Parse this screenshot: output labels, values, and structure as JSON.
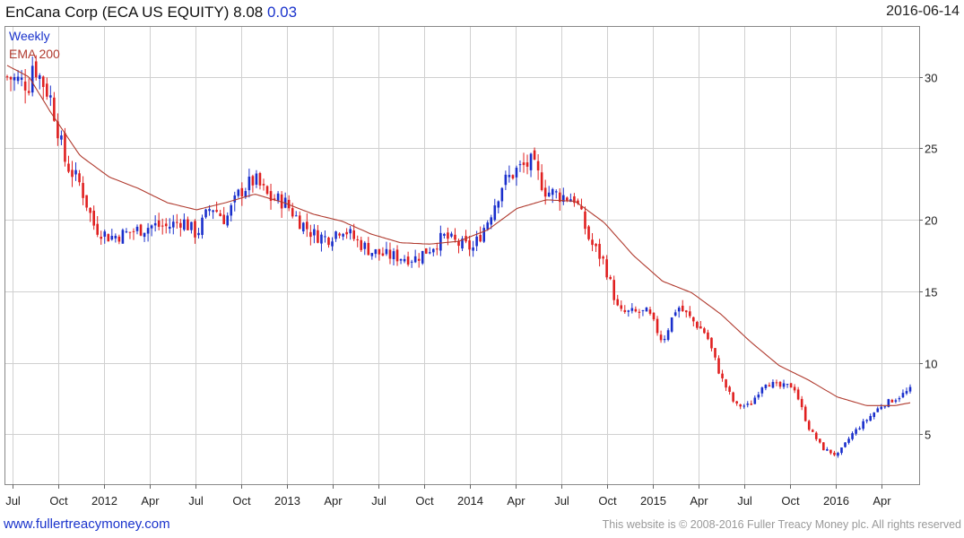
{
  "header": {
    "title": "EnCana Corp (ECA US EQUITY) 8.08",
    "change": "0.03",
    "date": "2016-06-14"
  },
  "legend": {
    "series1": "Weekly",
    "series2": "EMA 200"
  },
  "footer": {
    "site_link": "www.fullertreacymoney.com",
    "copyright": "This website is © 2008-2016 Fuller Treacy Money plc. All rights reserved"
  },
  "colors": {
    "up": "#1a2fcc",
    "down": "#e02020",
    "ema": "#b03a2e",
    "grid": "#d0d0d0"
  },
  "chart_data": {
    "type": "candlestick-line",
    "x_ticks": [
      "Jul",
      "Oct",
      "2012",
      "Apr",
      "Jul",
      "Oct",
      "2013",
      "Apr",
      "Jul",
      "Oct",
      "2014",
      "Apr",
      "Jul",
      "Oct",
      "2015",
      "Apr",
      "Jul",
      "Oct",
      "2016",
      "Apr"
    ],
    "y_ticks": [
      5,
      10,
      15,
      20,
      25,
      30
    ],
    "ylim": [
      1.5,
      33.5
    ],
    "grid": true,
    "legend_position": "top-left",
    "series": [
      {
        "name": "Weekly",
        "style": "candlestick",
        "points": [
          [
            0.0,
            30.0
          ],
          [
            3.0,
            29.5
          ],
          [
            3.5,
            31.0
          ],
          [
            6.0,
            28.5
          ],
          [
            8.0,
            24.0
          ],
          [
            10.0,
            22.5
          ],
          [
            12.0,
            19.5
          ],
          [
            14.0,
            18.8
          ],
          [
            16.0,
            19.0
          ],
          [
            18.0,
            19.3
          ],
          [
            20.0,
            19.6
          ],
          [
            22.0,
            19.5
          ],
          [
            24.0,
            20.0
          ],
          [
            26.0,
            19.0
          ],
          [
            28.0,
            21.0
          ],
          [
            30.0,
            20.0
          ],
          [
            32.0,
            22.0
          ],
          [
            34.0,
            22.8
          ],
          [
            36.0,
            21.5
          ],
          [
            38.0,
            21.3
          ],
          [
            40.0,
            20.0
          ],
          [
            42.0,
            19.0
          ],
          [
            44.0,
            18.7
          ],
          [
            46.0,
            19.5
          ],
          [
            48.0,
            18.5
          ],
          [
            50.0,
            17.8
          ],
          [
            52.0,
            17.5
          ],
          [
            54.0,
            17.4
          ],
          [
            56.0,
            17.3
          ],
          [
            58.0,
            18.0
          ],
          [
            60.0,
            18.8
          ],
          [
            62.0,
            18.3
          ],
          [
            64.0,
            18.0
          ],
          [
            66.0,
            20.0
          ],
          [
            68.0,
            22.5
          ],
          [
            70.0,
            23.5
          ],
          [
            72.0,
            24.0
          ],
          [
            74.0,
            22.0
          ],
          [
            76.0,
            21.7
          ],
          [
            78.0,
            21.5
          ],
          [
            80.0,
            18.5
          ],
          [
            82.0,
            17.0
          ],
          [
            84.0,
            13.5
          ],
          [
            86.0,
            13.5
          ],
          [
            88.0,
            13.5
          ],
          [
            90.0,
            11.5
          ],
          [
            92.0,
            14.0
          ],
          [
            94.0,
            13.0
          ],
          [
            96.0,
            12.0
          ],
          [
            98.0,
            9.0
          ],
          [
            100.0,
            7.0
          ],
          [
            102.0,
            7.0
          ],
          [
            104.0,
            8.7
          ],
          [
            106.0,
            8.3
          ],
          [
            108.0,
            8.4
          ],
          [
            110.0,
            5.5
          ],
          [
            112.0,
            4.0
          ],
          [
            114.0,
            3.5
          ],
          [
            116.0,
            5.0
          ],
          [
            118.0,
            6.0
          ],
          [
            120.0,
            7.0
          ],
          [
            122.0,
            7.5
          ],
          [
            124.0,
            8.1
          ]
        ]
      },
      {
        "name": "EMA 200",
        "style": "line",
        "points": [
          [
            0.0,
            30.8
          ],
          [
            3.0,
            30.0
          ],
          [
            6.0,
            27.5
          ],
          [
            10.0,
            24.5
          ],
          [
            14.0,
            23.0
          ],
          [
            18.0,
            22.2
          ],
          [
            22.0,
            21.2
          ],
          [
            26.0,
            20.7
          ],
          [
            30.0,
            21.2
          ],
          [
            34.0,
            21.8
          ],
          [
            38.0,
            21.2
          ],
          [
            42.0,
            20.4
          ],
          [
            46.0,
            19.9
          ],
          [
            50.0,
            19.0
          ],
          [
            54.0,
            18.4
          ],
          [
            58.0,
            18.3
          ],
          [
            62.0,
            18.5
          ],
          [
            66.0,
            19.3
          ],
          [
            70.0,
            20.8
          ],
          [
            74.0,
            21.4
          ],
          [
            78.0,
            21.3
          ],
          [
            82.0,
            19.8
          ],
          [
            86.0,
            17.5
          ],
          [
            90.0,
            15.7
          ],
          [
            94.0,
            14.9
          ],
          [
            98.0,
            13.4
          ],
          [
            102.0,
            11.5
          ],
          [
            106.0,
            9.8
          ],
          [
            110.0,
            8.8
          ],
          [
            114.0,
            7.6
          ],
          [
            118.0,
            7.0
          ],
          [
            122.0,
            7.0
          ],
          [
            124.0,
            7.2
          ]
        ]
      }
    ]
  }
}
